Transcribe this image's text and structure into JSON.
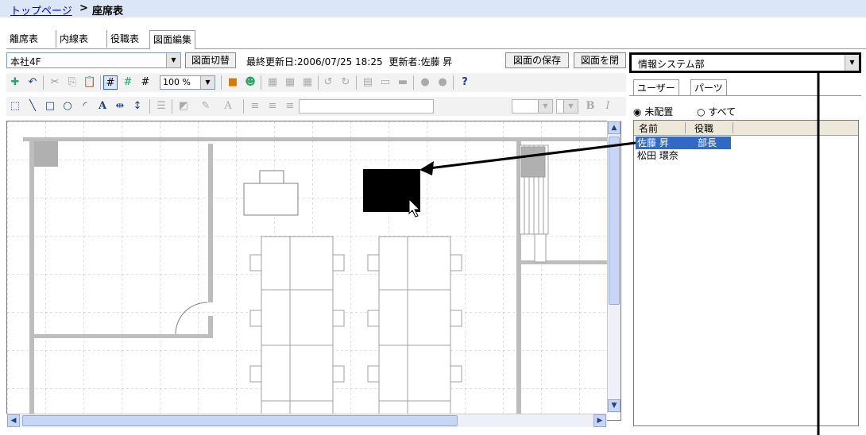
{
  "header": {
    "breadcrumb_link": "トップページ",
    "separator": ">",
    "page_title": "座席表"
  },
  "tabs": [
    {
      "label": "離席表"
    },
    {
      "label": "内線表"
    },
    {
      "label": "役職表"
    },
    {
      "label": "図面編集",
      "active": true
    }
  ],
  "toolbar": {
    "floor_value": "本社4F",
    "switch_label": "図面切替",
    "last_update_label": "最終更新日:2006/07/25 18:25",
    "updater_label": "更新者:佐藤 昇",
    "save_label": "図面の保存",
    "close_label": "図面を閉",
    "zoom_value": "100 %"
  },
  "right_panel": {
    "department_value": "情報システム部",
    "tab_user": "ユーザー",
    "tab_parts": "パーツ",
    "radio_unplaced": "未配置",
    "radio_all": "すべて",
    "radio_selected": "unplaced",
    "list_headers": {
      "name": "名前",
      "title": "役職"
    },
    "users": [
      {
        "name": "佐藤 昇",
        "title": "部長",
        "selected": true
      },
      {
        "name": "松田 環奈",
        "title": ""
      }
    ]
  },
  "colors": {
    "link": "#0000c8",
    "title_bar": "#dbe6f7",
    "selection": "#316ac5",
    "placed_seat": "#000000"
  }
}
